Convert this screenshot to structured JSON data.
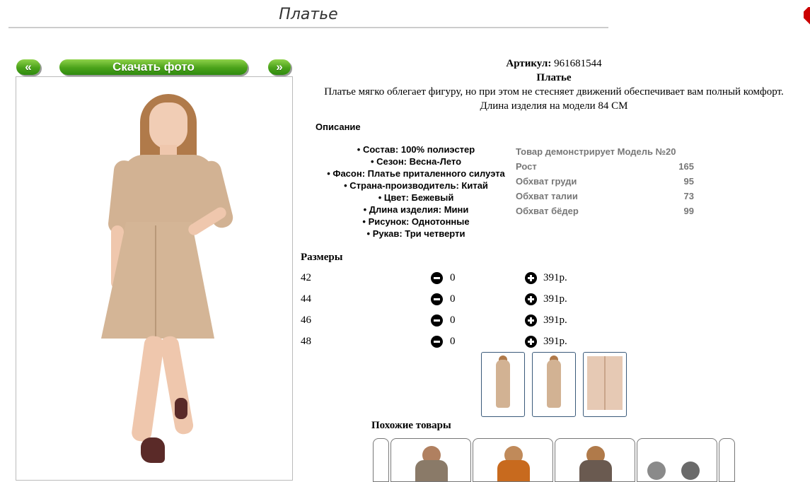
{
  "page": {
    "title": "Платье"
  },
  "gallery": {
    "prev_label": "«",
    "next_label": "»",
    "download_label": "Скачать фото"
  },
  "product": {
    "article_label": "Артикул:",
    "article_value": "961681544",
    "name": "Платье",
    "description": "Платье мягко облегает фигуру, но при этом не стесняет движений обеспечивает вам полный комфорт.",
    "length_note": "Длина изделия на модели 84 СМ"
  },
  "description_section": {
    "heading": "Описание",
    "properties": [
      "Состав: 100% полиэстер",
      "Сезон: Весна-Лето",
      "Фасон: Платье приталенного силуэта",
      "Страна-производитель: Китай",
      "Цвет: Бежевый",
      "Длина изделия: Мини",
      "Рисунок: Однотонные",
      "Рукав: Три четверти"
    ]
  },
  "model_info": {
    "heading": "Товар демонстрирует Модель №20",
    "rows": [
      {
        "label": "Рост",
        "value": "165"
      },
      {
        "label": "Обхват груди",
        "value": "95"
      },
      {
        "label": "Обхват талии",
        "value": "73"
      },
      {
        "label": "Обхват бёдер",
        "value": "99"
      }
    ]
  },
  "sizes": {
    "heading": "Размеры",
    "rows": [
      {
        "size": "42",
        "qty": "0",
        "price": "391р."
      },
      {
        "size": "44",
        "qty": "0",
        "price": "391р."
      },
      {
        "size": "46",
        "qty": "0",
        "price": "391р."
      },
      {
        "size": "48",
        "qty": "0",
        "price": "391р."
      }
    ]
  },
  "similar": {
    "heading": "Похожие товары"
  },
  "colors": {
    "accent_green": "#4aa21a",
    "dress_beige": "#d2b293",
    "close_red": "#cc0000"
  }
}
